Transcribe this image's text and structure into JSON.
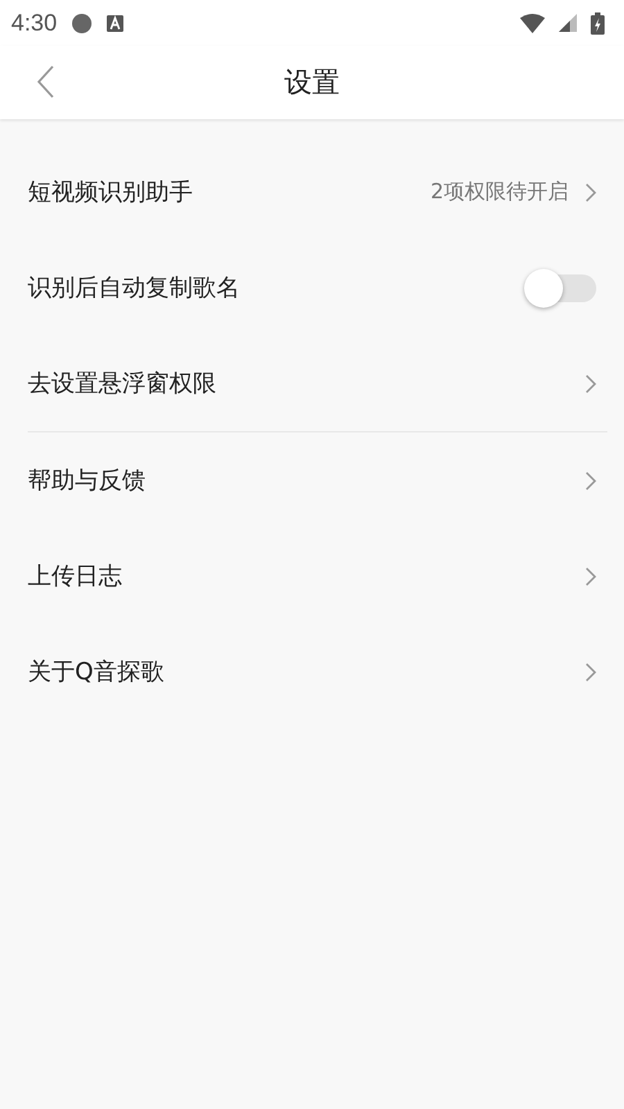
{
  "status_bar": {
    "time": "4:30"
  },
  "header": {
    "title": "设置"
  },
  "sections": [
    {
      "items": [
        {
          "kind": "link",
          "label": "短视频识别助手",
          "value": "2项权限待开启"
        },
        {
          "kind": "toggle",
          "label": "识别后自动复制歌名",
          "on": false
        },
        {
          "kind": "link",
          "label": "去设置悬浮窗权限"
        }
      ]
    },
    {
      "items": [
        {
          "kind": "link",
          "label": "帮助与反馈"
        },
        {
          "kind": "link",
          "label": "上传日志"
        },
        {
          "kind": "link",
          "label": "关于Q音探歌"
        }
      ]
    }
  ]
}
